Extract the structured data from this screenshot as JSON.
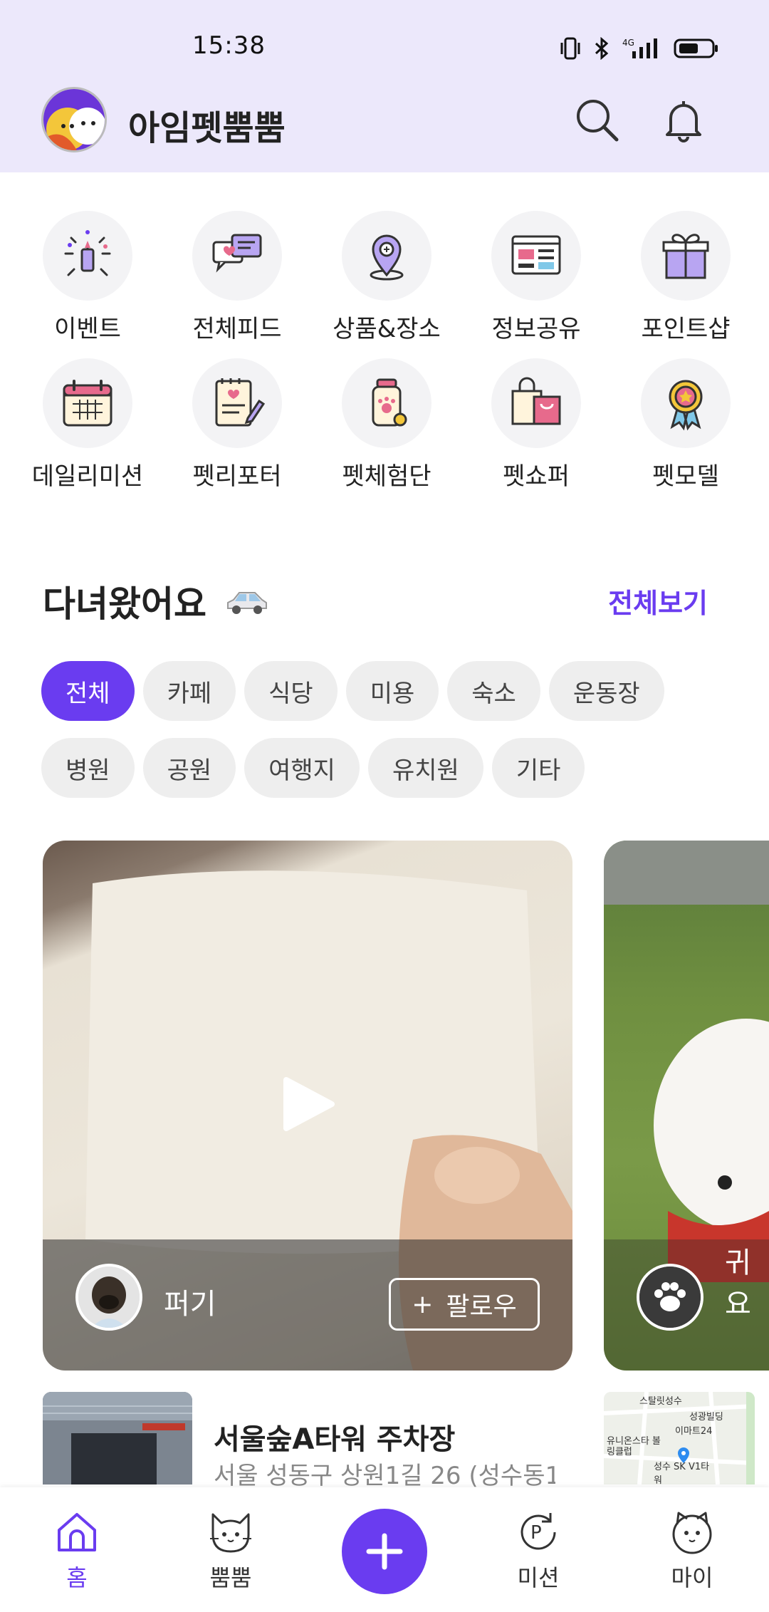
{
  "status_bar": {
    "time": "15:38",
    "network": "4G"
  },
  "header": {
    "title": "아임펫뿜뿜"
  },
  "categories": [
    {
      "label": "이벤트",
      "icon": "fireworks-icon"
    },
    {
      "label": "전체피드",
      "icon": "chat-bubbles-icon"
    },
    {
      "label": "상품&장소",
      "icon": "location-pin-icon"
    },
    {
      "label": "정보공유",
      "icon": "news-icon"
    },
    {
      "label": "포인트샵",
      "icon": "gift-icon"
    },
    {
      "label": "데일리미션",
      "icon": "calendar-icon"
    },
    {
      "label": "펫리포터",
      "icon": "notepad-icon"
    },
    {
      "label": "펫체험단",
      "icon": "pet-bottle-icon"
    },
    {
      "label": "펫쇼퍼",
      "icon": "shopping-bag-icon"
    },
    {
      "label": "펫모델",
      "icon": "medal-icon"
    }
  ],
  "section": {
    "title": "다녀왔어요",
    "more": "전체보기"
  },
  "chips": [
    "전체",
    "카페",
    "식당",
    "미용",
    "숙소",
    "운동장",
    "병원",
    "공원",
    "여행지",
    "유치원",
    "기타"
  ],
  "cards": [
    {
      "user": "퍼기",
      "follow": "팔로우"
    },
    {
      "user": "귀요"
    }
  ],
  "place": {
    "name": "서울숲A타워 주차장",
    "address": "서울 성동구 상원1길 26 (성수동1"
  },
  "map_labels": [
    "스탈릿성수",
    "성광빌딩",
    "이마트24",
    "유니온스타 볼링클럽",
    "성수 SK V1타워"
  ],
  "nav": {
    "home": "홈",
    "bbum": "뿜뿜",
    "mission": "미션",
    "my": "마이"
  },
  "colors": {
    "accent": "#6A3CF0",
    "header_bg": "#ECE8FB"
  }
}
